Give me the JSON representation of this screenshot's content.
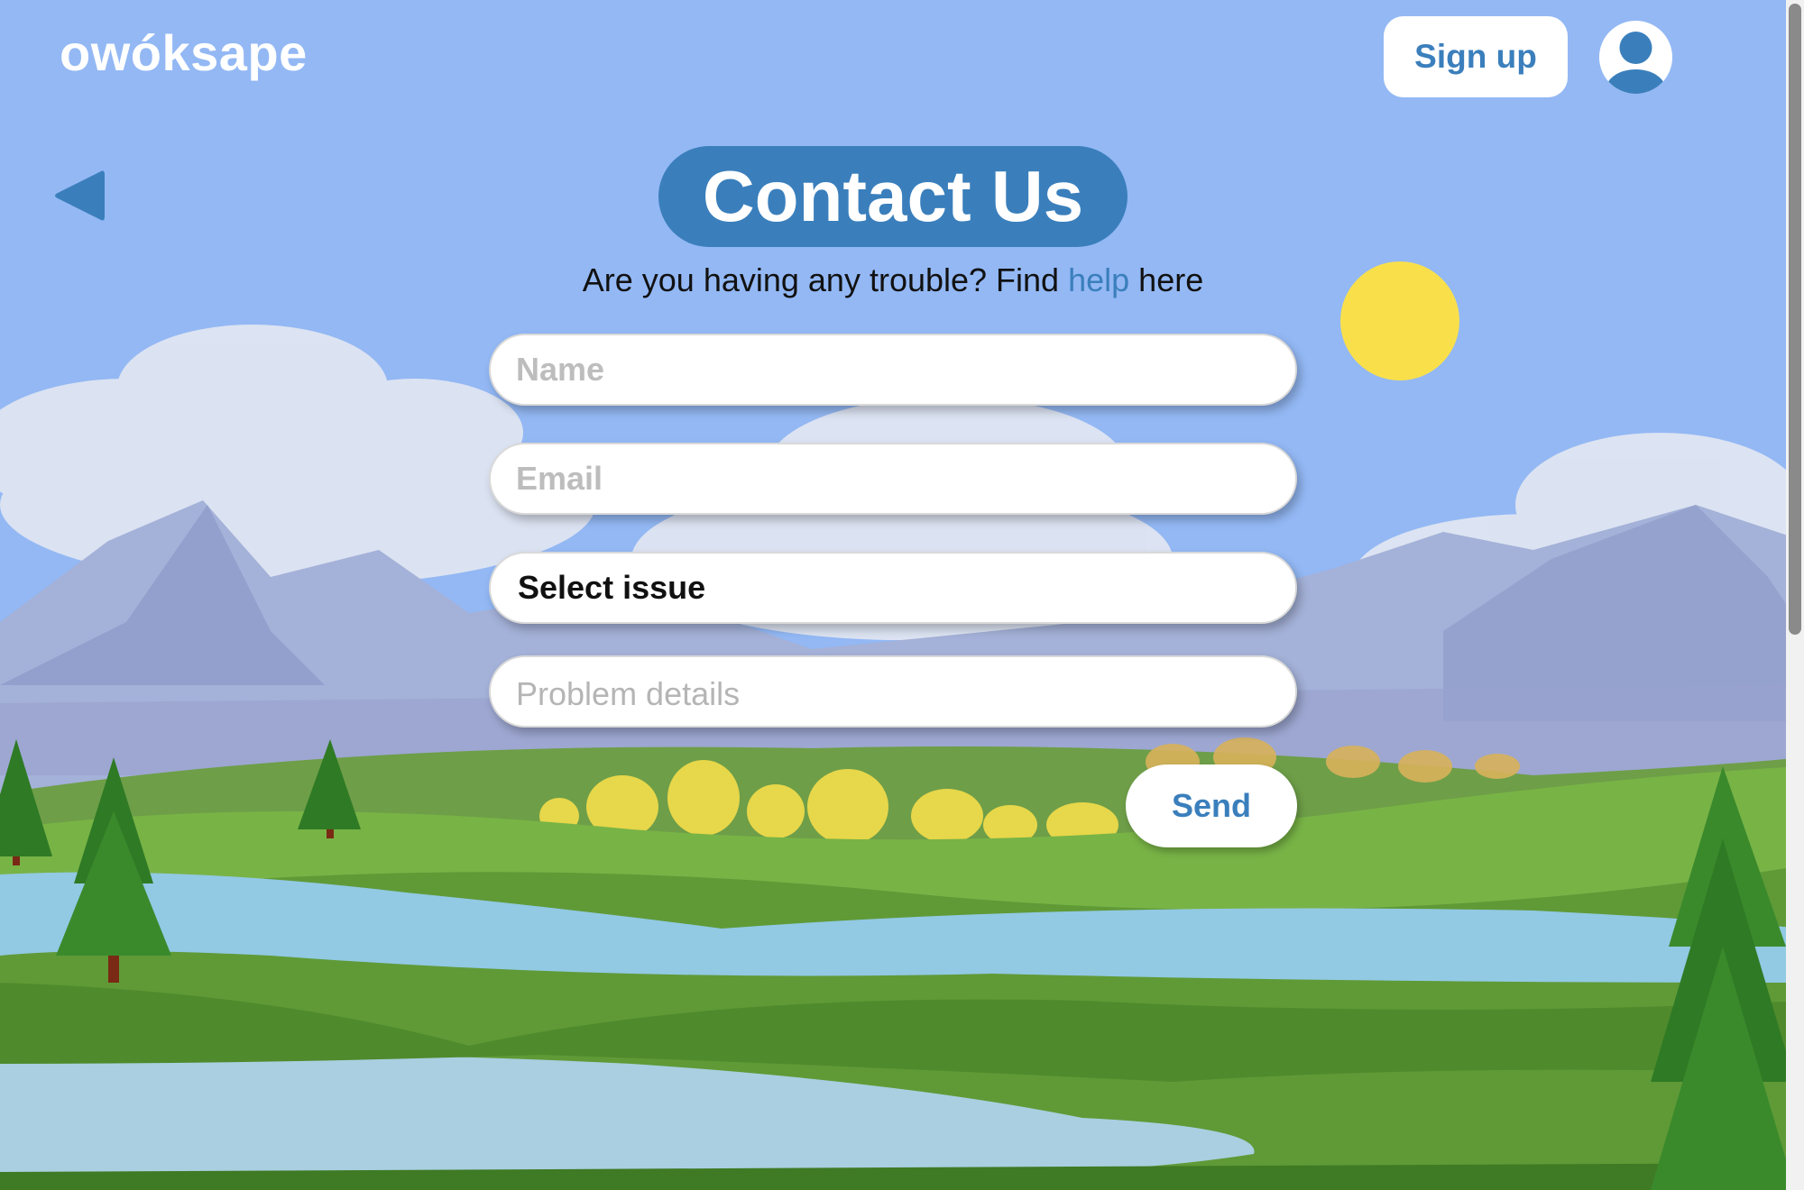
{
  "header": {
    "logo": "owóksape",
    "signup_label": "Sign up"
  },
  "icons": {
    "back": "back-triangle-icon",
    "avatar": "user-avatar-icon"
  },
  "main": {
    "title": "Contact Us",
    "subtitle_before": "Are you having any trouble? Find",
    "subtitle_link": "help",
    "subtitle_after": "here"
  },
  "form": {
    "name_placeholder": "Name",
    "email_placeholder": "Email",
    "issue_select": "Select issue",
    "details_placeholder": "Problem details",
    "send_label": "Send"
  },
  "colors": {
    "accent": "#3a7fbc",
    "sky": "#93b8f4",
    "sun": "#f9e04b"
  }
}
